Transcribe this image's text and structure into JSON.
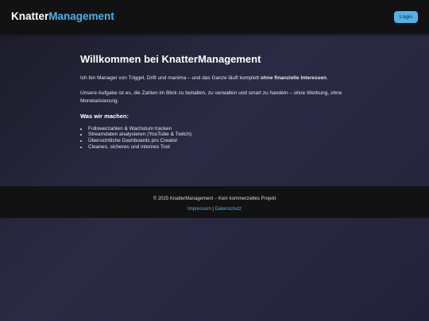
{
  "header": {
    "logo_part_1": "Knatter",
    "logo_part_2": "Management",
    "login_label": "Login"
  },
  "main": {
    "title": "Willkommen bei KnatterManagement",
    "intro_text": "Ich bin Manager von Triggel, Drift und manima – und das Ganze läuft komplett ",
    "intro_bold": "ohne finanzielle Interessen",
    "intro_end": ".",
    "mission_text": "Unsere Aufgabe ist es, die Zahlen im Blick zu behalten, zu verwalten und smart zu handeln – ohne Werbung, ohne Monetarisierung.",
    "section_heading": "Was wir machen:",
    "features": [
      "Followerzahlen & Wachstum tracken",
      "Streamdaten analysieren (YouTube & Twitch)",
      "Übersichtliche Dashboards pro Creator",
      "Cleanes, sicheres und internes Tool"
    ]
  },
  "footer": {
    "copyright": "© 2025 KnatterManagement – Kein kommerzielles Projekt",
    "link_impressum": "Impressum",
    "separator": " | ",
    "link_datenschutz": "Datenschutz"
  },
  "colors": {
    "accent": "#4fb3ea",
    "header_bg": "#121212",
    "body_bg": "#25253c"
  }
}
